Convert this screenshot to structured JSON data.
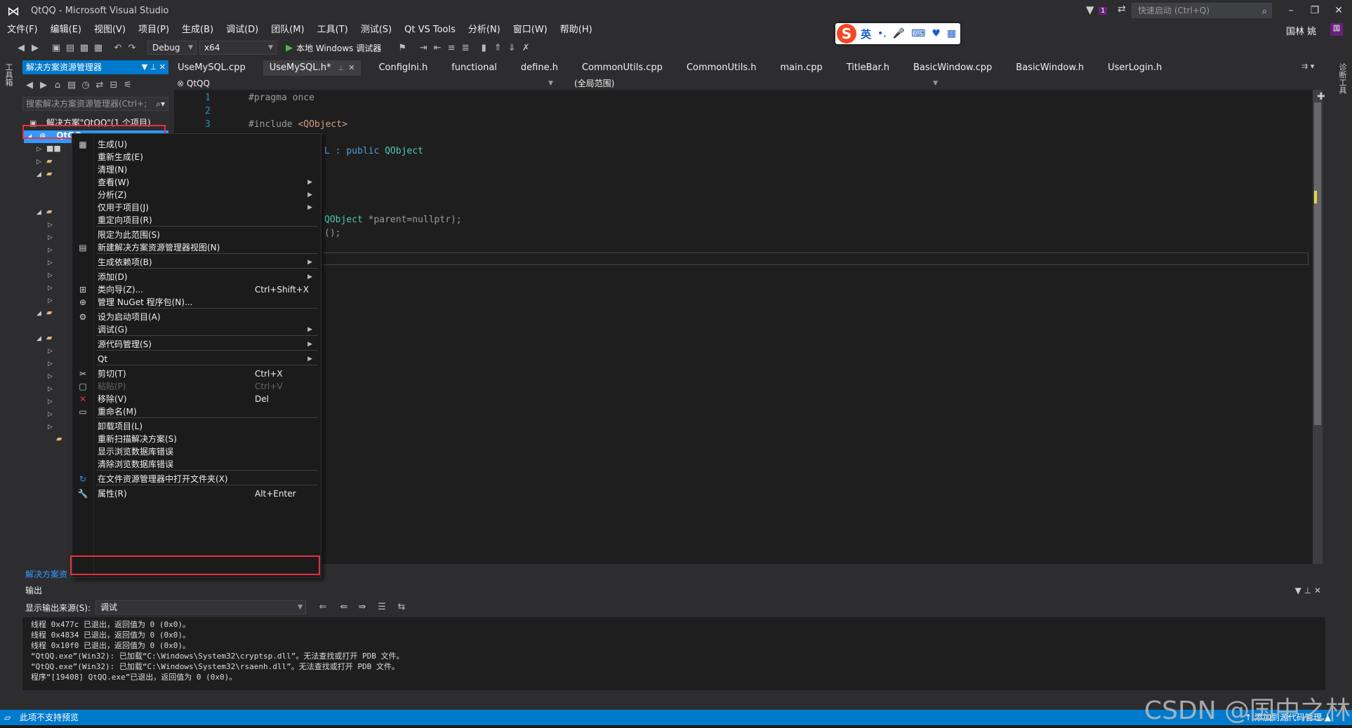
{
  "window": {
    "title": "QtQQ - Microsoft Visual Studio",
    "quick_launch_placeholder": "快速启动 (Ctrl+Q)",
    "notification_count": "1",
    "user_name": "国林 姚",
    "user_initial": "国",
    "accent_color": "#007acc"
  },
  "menu": [
    "文件(F)",
    "编辑(E)",
    "视图(V)",
    "项目(P)",
    "生成(B)",
    "调试(D)",
    "团队(M)",
    "工具(T)",
    "测试(S)",
    "Qt VS Tools",
    "分析(N)",
    "窗口(W)",
    "帮助(H)"
  ],
  "toolbar": {
    "configuration": "Debug",
    "platform": "x64",
    "debug_target": "本地 Windows 调试器"
  },
  "ime": {
    "lang": "英",
    "logo": "S"
  },
  "left_strip": {
    "toolbox": "工具箱"
  },
  "right_strip": {
    "diagnostics": "诊断工具"
  },
  "solution_explorer": {
    "title": "解决方案资源管理器",
    "search_placeholder": "搜索解决方案资源管理器(Ctrl+;",
    "solution_label": "解决方案\"QtQQ\"(1 个项目)",
    "project_label": "QtQQ",
    "footer_tab": "解决方案资"
  },
  "editor": {
    "tabs": [
      {
        "label": "UseMySQL.cpp",
        "active": false
      },
      {
        "label": "UseMySQL.h*",
        "active": true
      },
      {
        "label": "ConfigIni.h",
        "active": false
      },
      {
        "label": "functional",
        "active": false
      },
      {
        "label": "define.h",
        "active": false
      },
      {
        "label": "CommonUtils.cpp",
        "active": false
      },
      {
        "label": "CommonUtils.h",
        "active": false
      },
      {
        "label": "main.cpp",
        "active": false
      },
      {
        "label": "TitleBar.h",
        "active": false
      },
      {
        "label": "BasicWindow.cpp",
        "active": false
      },
      {
        "label": "BasicWindow.h",
        "active": false
      },
      {
        "label": "UserLogin.h",
        "active": false
      }
    ],
    "nav_project": "QtQQ",
    "nav_scope": "(全局范围)",
    "line_numbers": [
      "1",
      "2",
      "3"
    ],
    "code": {
      "line1": "#pragma once",
      "line3_pre": "#include ",
      "line3_str": "<QObject>",
      "class_frag_kw1": "L",
      "class_frag_rest": " : public ",
      "class_frag_cls": "QObject",
      "ctor_frag_cls": "QObject",
      "ctor_frag_rest": " *parent=nullptr);",
      "dtor_frag": "();"
    }
  },
  "context_menu": {
    "items": [
      {
        "icon": "build-icon",
        "glyph": "▦",
        "label": "生成(U)",
        "shortcut": "",
        "submenu": false
      },
      {
        "icon": "",
        "glyph": "",
        "label": "重新生成(E)",
        "shortcut": "",
        "submenu": false
      },
      {
        "icon": "",
        "glyph": "",
        "label": "清理(N)",
        "shortcut": "",
        "submenu": false
      },
      {
        "icon": "",
        "glyph": "",
        "label": "查看(W)",
        "shortcut": "",
        "submenu": true
      },
      {
        "icon": "",
        "glyph": "",
        "label": "分析(Z)",
        "shortcut": "",
        "submenu": true
      },
      {
        "icon": "",
        "glyph": "",
        "label": "仅用于项目(J)",
        "shortcut": "",
        "submenu": true
      },
      {
        "icon": "",
        "glyph": "",
        "label": "重定向项目(R)",
        "shortcut": "",
        "submenu": false
      },
      {
        "sep": true
      },
      {
        "icon": "",
        "glyph": "",
        "label": "限定为此范围(S)",
        "shortcut": "",
        "submenu": false
      },
      {
        "icon": "new-view-icon",
        "glyph": "▤",
        "label": "新建解决方案资源管理器视图(N)",
        "shortcut": "",
        "submenu": false
      },
      {
        "sep": true
      },
      {
        "icon": "",
        "glyph": "",
        "label": "生成依赖项(B)",
        "shortcut": "",
        "submenu": true
      },
      {
        "sep": true
      },
      {
        "icon": "",
        "glyph": "",
        "label": "添加(D)",
        "shortcut": "",
        "submenu": true
      },
      {
        "icon": "class-wizard-icon",
        "glyph": "⊞",
        "label": "类向导(Z)...",
        "shortcut": "Ctrl+Shift+X",
        "submenu": false
      },
      {
        "icon": "nuget-icon",
        "glyph": "⊕",
        "label": "管理 NuGet 程序包(N)...",
        "shortcut": "",
        "submenu": false
      },
      {
        "sep": true
      },
      {
        "icon": "gear-icon",
        "glyph": "⚙",
        "label": "设为启动项目(A)",
        "shortcut": "",
        "submenu": false
      },
      {
        "icon": "",
        "glyph": "",
        "label": "调试(G)",
        "shortcut": "",
        "submenu": true
      },
      {
        "sep": true
      },
      {
        "icon": "",
        "glyph": "",
        "label": "源代码管理(S)",
        "shortcut": "",
        "submenu": true
      },
      {
        "sep": true
      },
      {
        "icon": "",
        "glyph": "",
        "label": "Qt",
        "shortcut": "",
        "submenu": true
      },
      {
        "sep": true
      },
      {
        "icon": "scissors-icon",
        "glyph": "✂",
        "label": "剪切(T)",
        "shortcut": "Ctrl+X",
        "submenu": false
      },
      {
        "icon": "paste-icon",
        "glyph": "▢",
        "label": "粘贴(P)",
        "shortcut": "Ctrl+V",
        "submenu": false,
        "disabled": true
      },
      {
        "icon": "remove-icon",
        "glyph": "✕",
        "label": "移除(V)",
        "shortcut": "Del",
        "submenu": false
      },
      {
        "icon": "rename-icon",
        "glyph": "▭",
        "label": "重命名(M)",
        "shortcut": "",
        "submenu": false
      },
      {
        "sep": true
      },
      {
        "icon": "",
        "glyph": "",
        "label": "卸载项目(L)",
        "shortcut": "",
        "submenu": false
      },
      {
        "icon": "",
        "glyph": "",
        "label": "重新扫描解决方案(S)",
        "shortcut": "",
        "submenu": false
      },
      {
        "icon": "",
        "glyph": "",
        "label": "显示浏览数据库错误",
        "shortcut": "",
        "submenu": false
      },
      {
        "icon": "",
        "glyph": "",
        "label": "清除浏览数据库错误",
        "shortcut": "",
        "submenu": false
      },
      {
        "sep": true
      },
      {
        "icon": "open-folder-icon",
        "glyph": "↻",
        "label": "在文件资源管理器中打开文件夹(X)",
        "shortcut": "",
        "submenu": false
      },
      {
        "sep": true
      },
      {
        "icon": "wrench-icon",
        "glyph": "🔧",
        "label": "属性(R)",
        "shortcut": "Alt+Enter",
        "submenu": false,
        "highlight": true
      }
    ]
  },
  "output": {
    "title": "输出",
    "source_label": "显示输出来源(S):",
    "source_value": "调试",
    "lines": [
      "线程 0x477c 已退出，返回值为 0 (0x0)。",
      "线程 0x4834 已退出，返回值为 0 (0x0)。",
      "线程 0x10f0 已退出，返回值为 0 (0x0)。",
      "“QtQQ.exe”(Win32): 已加载“C:\\Windows\\System32\\cryptsp.dll”。无法查找或打开 PDB 文件。",
      "“QtQQ.exe”(Win32): 已加载“C:\\Windows\\System32\\rsaenh.dll”。无法查找或打开 PDB 文件。",
      "程序“[19408] QtQQ.exe”已退出，返回值为 0 (0x0)。"
    ]
  },
  "status": {
    "text": "此项不支持预览",
    "right": "↑ 添加到源代码管理 ▲"
  },
  "watermark": "CSDN @国中之林"
}
